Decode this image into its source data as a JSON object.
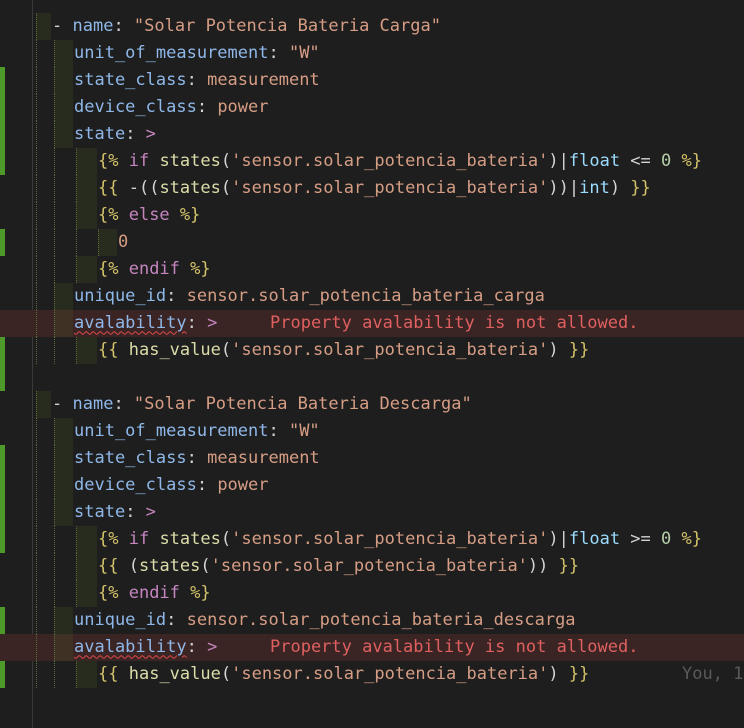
{
  "lines": [
    {
      "segs": [
        [
          "- ",
          "dash"
        ],
        [
          "name",
          "k"
        ],
        [
          ": ",
          "p"
        ],
        [
          "\"Solar Potencia Bateria Carga\"",
          "s"
        ]
      ]
    },
    {
      "segs": [
        [
          "unit_of_measurement",
          "k"
        ],
        [
          ": ",
          "p"
        ],
        [
          "\"W\"",
          "s"
        ]
      ]
    },
    {
      "segs": [
        [
          "state_class",
          "k"
        ],
        [
          ": ",
          "p"
        ],
        [
          "measurement",
          "v"
        ]
      ]
    },
    {
      "segs": [
        [
          "device_class",
          "k"
        ],
        [
          ": ",
          "p"
        ],
        [
          "power",
          "v"
        ]
      ]
    },
    {
      "segs": [
        [
          "state",
          "k"
        ],
        [
          ": ",
          "p"
        ],
        [
          ">",
          "kw"
        ]
      ]
    },
    {
      "segs": [
        [
          "{%",
          "d"
        ],
        [
          " if ",
          "kw"
        ],
        [
          "states",
          "f"
        ],
        [
          "(",
          "p"
        ],
        [
          "'sensor.solar_potencia_bateria'",
          "s"
        ],
        [
          ")|",
          "p"
        ],
        [
          "float",
          "t"
        ],
        [
          " <= ",
          "p"
        ],
        [
          "0",
          "n"
        ],
        [
          " %}",
          "d"
        ]
      ]
    },
    {
      "segs": [
        [
          "{{",
          "d"
        ],
        [
          " -((",
          "p"
        ],
        [
          "states",
          "f"
        ],
        [
          "(",
          "p"
        ],
        [
          "'sensor.solar_potencia_bateria'",
          "s"
        ],
        [
          "))|",
          "p"
        ],
        [
          "int",
          "t"
        ],
        [
          ") ",
          "p"
        ],
        [
          "}}",
          "d"
        ]
      ]
    },
    {
      "segs": [
        [
          "{%",
          "d"
        ],
        [
          " else ",
          "kw"
        ],
        [
          "%}",
          "d"
        ]
      ]
    },
    {
      "segs": [
        [
          "0",
          "s"
        ]
      ]
    },
    {
      "segs": [
        [
          "{%",
          "d"
        ],
        [
          " endif ",
          "kw"
        ],
        [
          "%}",
          "d"
        ]
      ]
    },
    {
      "segs": [
        [
          "unique_id",
          "k"
        ],
        [
          ": ",
          "p"
        ],
        [
          "sensor.solar_potencia_bateria_carga",
          "v"
        ]
      ]
    },
    {
      "segs": [
        [
          "avalability",
          "k squiggle"
        ],
        [
          ": ",
          "p"
        ],
        [
          ">",
          "kw"
        ]
      ],
      "diagnostic": "Property avalability is not allowed."
    },
    {
      "segs": [
        [
          "{{",
          "d"
        ],
        [
          " ",
          "p"
        ],
        [
          "has_value",
          "f"
        ],
        [
          "(",
          "p"
        ],
        [
          "'sensor.solar_potencia_bateria'",
          "s"
        ],
        [
          ") ",
          "p"
        ],
        [
          "}}",
          "d"
        ]
      ]
    },
    {
      "segs": []
    },
    {
      "segs": [
        [
          "- ",
          "dash"
        ],
        [
          "name",
          "k"
        ],
        [
          ": ",
          "p"
        ],
        [
          "\"Solar Potencia Bateria Descarga\"",
          "s"
        ]
      ]
    },
    {
      "segs": [
        [
          "unit_of_measurement",
          "k"
        ],
        [
          ": ",
          "p"
        ],
        [
          "\"W\"",
          "s"
        ]
      ]
    },
    {
      "segs": [
        [
          "state_class",
          "k"
        ],
        [
          ": ",
          "p"
        ],
        [
          "measurement",
          "v"
        ]
      ]
    },
    {
      "segs": [
        [
          "device_class",
          "k"
        ],
        [
          ": ",
          "p"
        ],
        [
          "power",
          "v"
        ]
      ]
    },
    {
      "segs": [
        [
          "state",
          "k"
        ],
        [
          ": ",
          "p"
        ],
        [
          ">",
          "kw"
        ]
      ]
    },
    {
      "segs": [
        [
          "{%",
          "d"
        ],
        [
          " if ",
          "kw"
        ],
        [
          "states",
          "f"
        ],
        [
          "(",
          "p"
        ],
        [
          "'sensor.solar_potencia_bateria'",
          "s"
        ],
        [
          ")|",
          "p"
        ],
        [
          "float",
          "t"
        ],
        [
          " >= ",
          "p"
        ],
        [
          "0",
          "n"
        ],
        [
          " %}",
          "d"
        ]
      ]
    },
    {
      "segs": [
        [
          "{{",
          "d"
        ],
        [
          " (",
          "p"
        ],
        [
          "states",
          "f"
        ],
        [
          "(",
          "p"
        ],
        [
          "'sensor.solar_potencia_bateria'",
          "s"
        ],
        [
          ")) ",
          "p"
        ],
        [
          "}}",
          "d"
        ]
      ]
    },
    {
      "segs": [
        [
          "{%",
          "d"
        ],
        [
          " endif ",
          "kw"
        ],
        [
          "%}",
          "d"
        ]
      ]
    },
    {
      "segs": [
        [
          "unique_id",
          "k"
        ],
        [
          ": ",
          "p"
        ],
        [
          "sensor.solar_potencia_bateria_descarga",
          "v"
        ]
      ]
    },
    {
      "segs": [
        [
          "avalability",
          "k squiggle"
        ],
        [
          ": ",
          "p"
        ],
        [
          ">",
          "kw"
        ]
      ],
      "diagnostic": "Property avalability is not allowed."
    },
    {
      "segs": [
        [
          "{{",
          "d"
        ],
        [
          " ",
          "p"
        ],
        [
          "has_value",
          "f"
        ],
        [
          "(",
          "p"
        ],
        [
          "'sensor.solar_potencia_bateria'",
          "s"
        ],
        [
          ") ",
          "p"
        ],
        [
          "}}",
          "d"
        ]
      ],
      "blame": "You, 1"
    }
  ],
  "colors": {
    "background": "#1e1e1e",
    "git_added": "#4d9a2b",
    "error_line": "#3a2424",
    "error_text": "#e06060"
  }
}
